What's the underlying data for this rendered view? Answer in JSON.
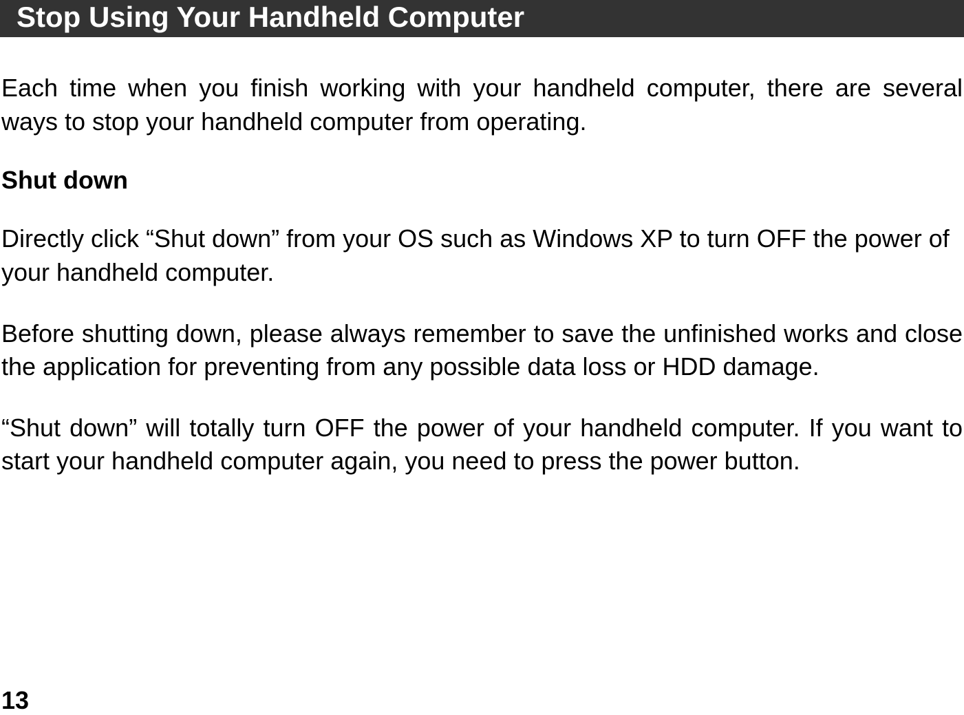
{
  "heading": "Stop Using Your Handheld Computer",
  "intro": "Each time when you finish working with your handheld computer, there are several ways to stop your handheld computer from operating.",
  "section": {
    "title": "Shut down",
    "paragraphs": [
      "Directly click “Shut down” from your OS such as Windows XP to turn OFF the power of your handheld computer.",
      "Before shutting down, please always remember to save the unfinished works and close the application for preventing from any possible data loss or HDD damage.",
      "“Shut down” will totally turn OFF the power of your handheld computer. If you want to start your handheld computer again, you need to press the power button."
    ]
  },
  "page_number": "13"
}
